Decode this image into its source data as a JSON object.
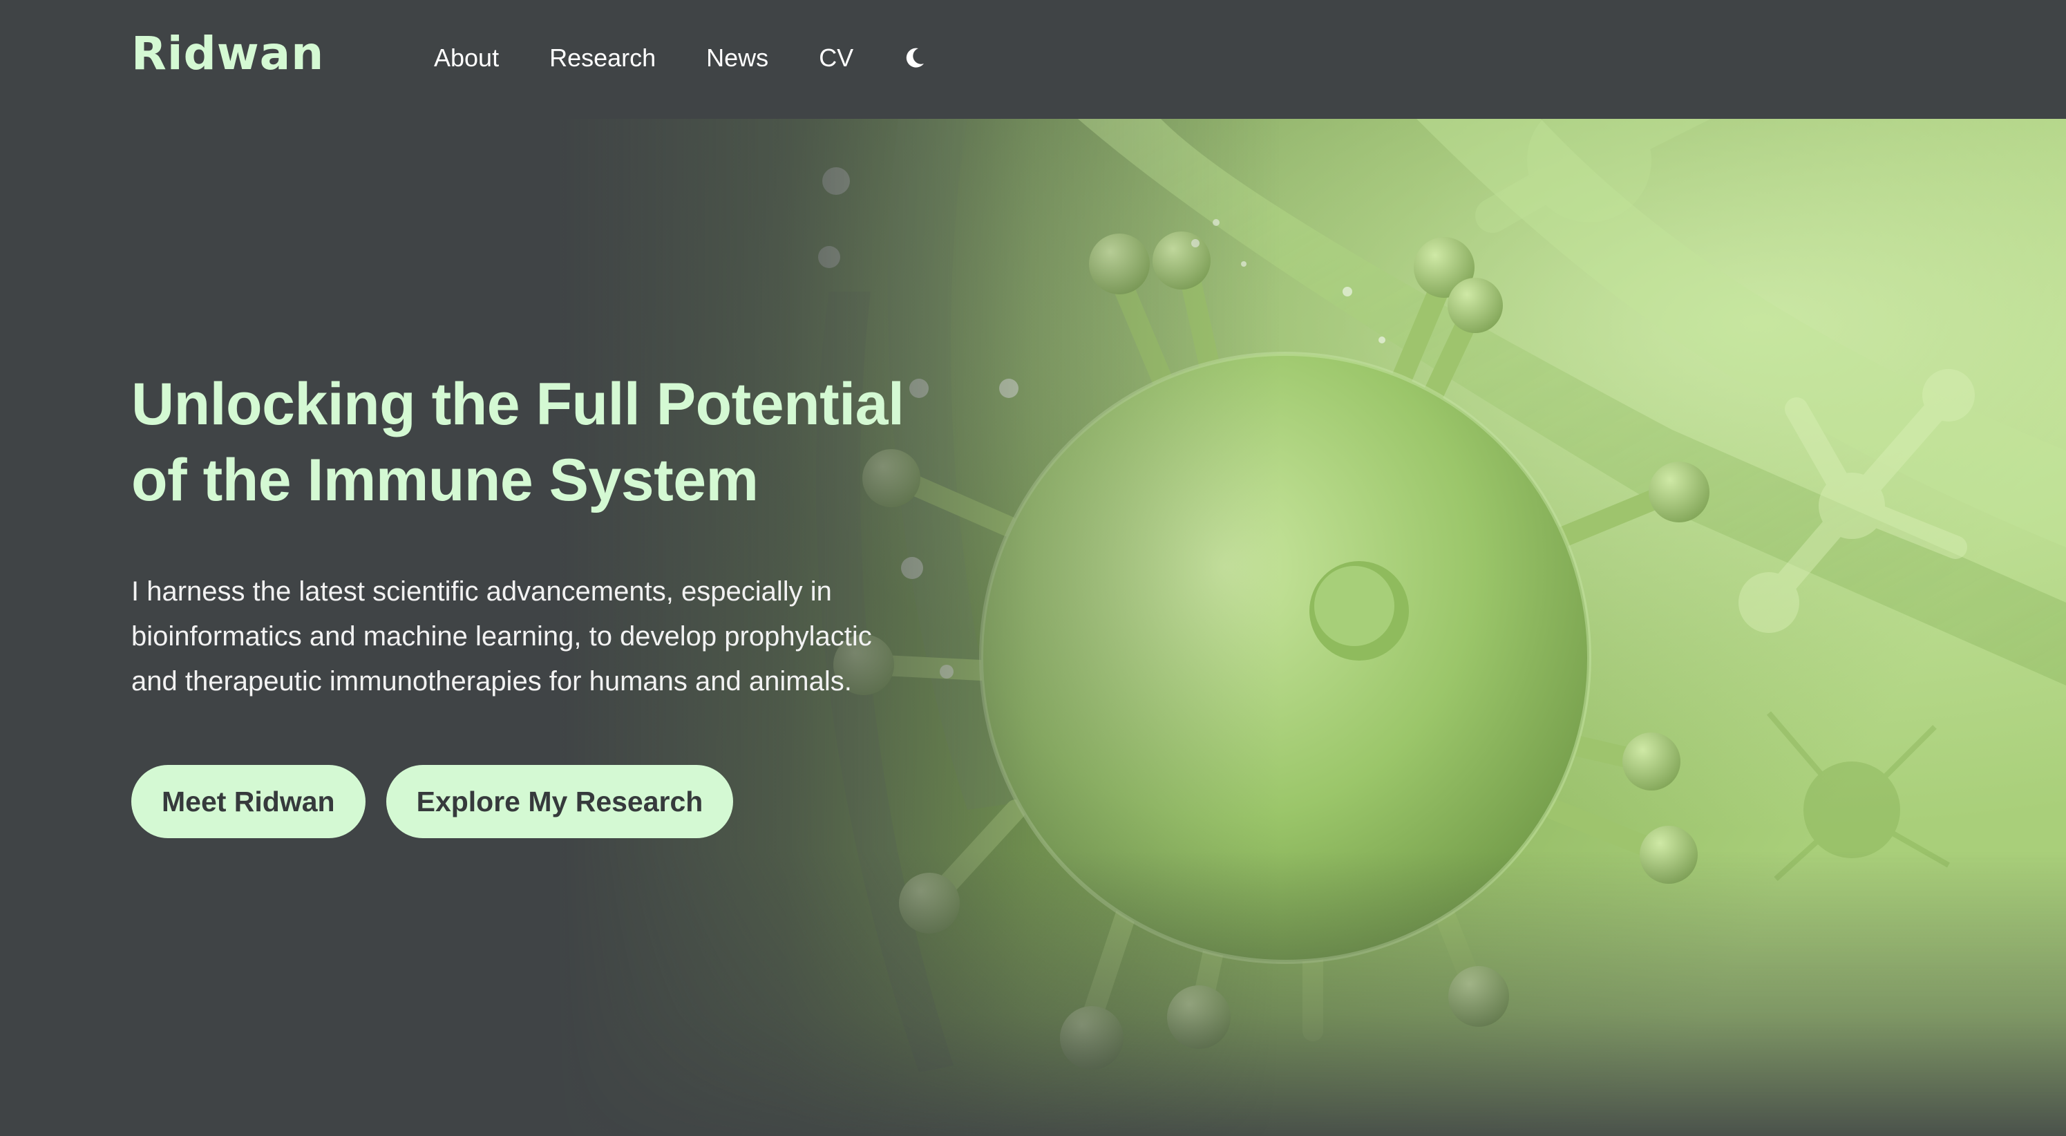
{
  "header": {
    "logo": "Ridwan",
    "nav": [
      {
        "label": "About"
      },
      {
        "label": "Research"
      },
      {
        "label": "News"
      },
      {
        "label": "CV"
      }
    ],
    "theme_toggle_icon": "moon-icon"
  },
  "hero": {
    "title_line1": "Unlocking the Full Potential",
    "title_line2": "of the Immune System",
    "description": "I harness the latest scientific advancements, especially in bioinformatics and machine learning, to develop prophylactic and therapeutic immunotherapies for humans and animals.",
    "buttons": {
      "primary": "Meet Ridwan",
      "secondary": "Explore My Research"
    },
    "background_image": "virus-illustration"
  },
  "colors": {
    "background": "#404446",
    "accent": "#d4f9d3",
    "button_text": "#363a3c",
    "virus_green": "#8fbf5e"
  }
}
